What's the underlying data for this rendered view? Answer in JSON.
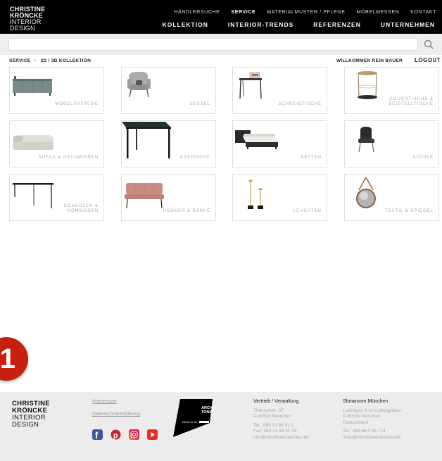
{
  "header": {
    "logo": [
      "CHRISTINE",
      "KRÖNCKE",
      "INTERIOR",
      "DESIGN"
    ],
    "nav_top": [
      {
        "label": "HÄNDLERSUCHE",
        "active": false
      },
      {
        "label": "SERVICE",
        "active": true
      },
      {
        "label": "MATERIALMUSTER / PFLEGE",
        "active": false
      },
      {
        "label": "MÖBELMESSEN",
        "active": false
      },
      {
        "label": "KONTAKT",
        "active": false
      }
    ],
    "nav_bottom": [
      "KOLLEKTION",
      "INTERIOR-TRENDS",
      "REFERENZEN",
      "UNTERNEHMEN"
    ]
  },
  "search": {
    "placeholder": "",
    "value": ""
  },
  "breadcrumb": {
    "items": [
      "SERVICE",
      "2D / 3D KOLLEKTION"
    ],
    "separator": ">"
  },
  "account": {
    "welcome": "WILLKOMMEN REIN BAUER",
    "logout": "LOGOUT"
  },
  "tiles": [
    {
      "label": "MÖBELSYSTEME",
      "icon": "sideboard-icon"
    },
    {
      "label": "SESSEL",
      "icon": "armchair-icon"
    },
    {
      "label": "SCHREIBTISCHE",
      "icon": "desk-icon"
    },
    {
      "label": "COUCHTISCHE & BEISTELLTISCHE",
      "icon": "side-table-icon"
    },
    {
      "label": "SOFAS & RECAMIEREN",
      "icon": "sofa-icon"
    },
    {
      "label": "ESSTISCHE",
      "icon": "dining-table-icon"
    },
    {
      "label": "BETTEN",
      "icon": "bed-icon"
    },
    {
      "label": "STÜHLE",
      "icon": "chair-icon"
    },
    {
      "label": "KONSOLEN & KOMMODEN",
      "icon": "console-icon"
    },
    {
      "label": "HOCKER & BÄNKE",
      "icon": "bench-icon"
    },
    {
      "label": "LEUCHTEN",
      "icon": "lamp-icon"
    },
    {
      "label": "TEXTIL & SPIEGEL",
      "icon": "mirror-icon"
    }
  ],
  "badge": "1",
  "footer": {
    "logo": [
      "CHRISTINE",
      "KRÖNCKE",
      "INTERIOR",
      "DESIGN"
    ],
    "links": [
      "Impressum",
      "Datenschutzerklärung"
    ],
    "social": [
      "facebook-icon",
      "pinterest-icon",
      "instagram-icon",
      "youtube-icon"
    ],
    "archi": {
      "line1": "ARCHI",
      "line2": "TONIC",
      "follow": "follow us on"
    },
    "vertrieb": {
      "title": "Vertrieb / Verwaltung",
      "address": [
        "Thierschstr. 37",
        "D-80538 München"
      ],
      "contact": [
        "Tel.: 089 21 88 91 0",
        "Fax: 089 21 88 91 19",
        "info@christinekroencke.net"
      ]
    },
    "showroom": {
      "title": "Showroom München",
      "address": [
        "Ludwigstr. 6 im Ludwigpalais",
        "D-80539 München",
        "Deutschland"
      ],
      "contact": [
        "Tel.: 089 66 0 66 714",
        "shop@christinekroencke.net"
      ]
    }
  },
  "colors": {
    "header_bg": "#000000",
    "footer_bg": "#ececec",
    "badge": "#c82010",
    "tile_border": "#e0e0e0",
    "label_gray": "#aaaaaa"
  }
}
